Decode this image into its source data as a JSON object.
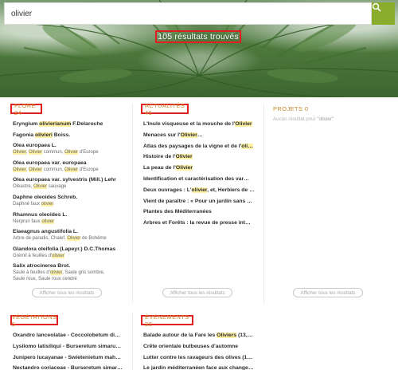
{
  "search": {
    "value": "olivier"
  },
  "result_count": "105 résultats trouvés",
  "highlight_color": "#fff1a6",
  "accent_color": "#8aac2d",
  "title_color": "#c8892c",
  "flore": {
    "title": "FLORE 24",
    "items": [
      {
        "title": [
          [
            "Eryngium ",
            0
          ],
          [
            "olivierianum",
            1
          ],
          [
            " F.Delaroche",
            0
          ]
        ],
        "sub": []
      },
      {
        "title": [
          [
            "Fagonia ",
            0
          ],
          [
            "olivieri",
            1
          ],
          [
            " Boiss.",
            0
          ]
        ],
        "sub": []
      },
      {
        "title": [
          [
            "Olea europaea L.",
            0
          ]
        ],
        "sub": [
          [
            [
              "Olivier",
              1
            ],
            [
              ", ",
              0
            ],
            [
              "Olivier",
              1
            ],
            [
              " commun, ",
              0
            ],
            [
              "Olivier",
              1
            ],
            [
              " d'Europe",
              0
            ]
          ]
        ]
      },
      {
        "title": [
          [
            "Olea europaea var. europaea",
            0
          ]
        ],
        "sub": [
          [
            [
              "Olivier",
              1
            ],
            [
              ", ",
              0
            ],
            [
              "Olivier",
              1
            ],
            [
              " commun, ",
              0
            ],
            [
              "Olivier",
              1
            ],
            [
              " d'Europe",
              0
            ]
          ]
        ]
      },
      {
        "title": [
          [
            "Olea europaea var. sylvestris (Mill.) Lehr",
            0
          ]
        ],
        "sub": [
          [
            [
              "Oléastre, ",
              0
            ],
            [
              "Olivier",
              1
            ],
            [
              " sauvage",
              0
            ]
          ]
        ]
      },
      {
        "title": [
          [
            "Daphne oleoides Schreb.",
            0
          ]
        ],
        "sub": [
          [
            [
              "Daphné faux ",
              0
            ],
            [
              "olivier",
              1
            ]
          ]
        ]
      },
      {
        "title": [
          [
            "Rhamnus oleoides L.",
            0
          ]
        ],
        "sub": [
          [
            [
              "Nerprun faux ",
              0
            ],
            [
              "olivier",
              1
            ]
          ]
        ]
      },
      {
        "title": [
          [
            "Elaeagnus angustifolia L.",
            0
          ]
        ],
        "sub": [
          [
            [
              "Arbre de paradis, Chalef, ",
              0
            ],
            [
              "Olivier",
              1
            ],
            [
              " de Bohême",
              0
            ]
          ]
        ]
      },
      {
        "title": [
          [
            "Glandora oleifolia (Lapeyr.) D.C.Thomas",
            0
          ]
        ],
        "sub": [
          [
            [
              "Grémil à feuilles d'",
              0
            ],
            [
              "olivier",
              1
            ]
          ]
        ]
      },
      {
        "title": [
          [
            "Salix atrocinerea Brot.",
            0
          ]
        ],
        "sub": [
          [
            [
              "Saule à feuilles d'",
              0
            ],
            [
              "olivier",
              1
            ],
            [
              ", Saule gris sombre,",
              0
            ]
          ],
          [
            [
              "Saule roux, Saule roux cendré",
              0
            ]
          ]
        ]
      }
    ],
    "show_all": "Afficher tous les résultats"
  },
  "actualites": {
    "title": "ACTUALITÉS 46",
    "items": [
      [
        [
          "L'Inule visqueuse et la mouche de l'",
          0
        ],
        [
          "Olivier",
          1
        ]
      ],
      [
        [
          "Menaces sur l'",
          0
        ],
        [
          "Olivier",
          1
        ],
        [
          "…",
          0
        ]
      ],
      [
        [
          "Atlas des paysages de la vigne et de l'",
          0
        ],
        [
          "oli…",
          1
        ]
      ],
      [
        [
          "Histoire de l'",
          0
        ],
        [
          "Olivier",
          1
        ]
      ],
      [
        [
          "La peau de l'",
          0
        ],
        [
          "Olivier",
          1
        ]
      ],
      [
        [
          "Identification et caractérisation des var…",
          0
        ]
      ],
      [
        [
          "Deux ouvrages : L'",
          0
        ],
        [
          "olivier",
          1
        ],
        [
          ", et, Herbiers de …",
          0
        ]
      ],
      [
        [
          "Vient de paraître : « Pour un jardin sans …",
          0
        ]
      ],
      [
        [
          "Plantes des Méditerranées",
          0
        ]
      ],
      [
        [
          "Arbres et Forêts : la revue de presse int…",
          0
        ]
      ]
    ],
    "show_all": "Afficher tous les résultats"
  },
  "projets": {
    "title": "PROJETS 0",
    "empty_prefix": "Aucun résultat pour ",
    "empty_query": "\"olivier\"",
    "show_all": "Afficher tous les résultats"
  },
  "vegetations": {
    "title": "VÉGÉTATIONS 5",
    "items": [
      [
        [
          "Oxandro lanceolatae - Coccolobetum di…",
          0
        ]
      ],
      [
        [
          "Lysilomo latisiliqui - Burseretum simaru…",
          0
        ]
      ],
      [
        [
          "Junipero lucayanae - Swietenietum mah…",
          0
        ]
      ],
      [
        [
          "Nectandro coriaceae - Burseretum simar…",
          0
        ]
      ]
    ]
  },
  "evenements": {
    "title": "ÉVÉNEMENTS 30",
    "items": [
      [
        [
          "Balade autour de la Fare les ",
          0
        ],
        [
          "Oliviers",
          1
        ],
        [
          " (13,…",
          0
        ]
      ],
      [
        [
          "Crête orientale bulbeuses d'automne",
          0
        ]
      ],
      [
        [
          "Lutter contre les ravageurs des olives (1…",
          0
        ]
      ],
      [
        [
          "Le jardin méditerranéen face aux change…",
          0
        ]
      ]
    ]
  }
}
